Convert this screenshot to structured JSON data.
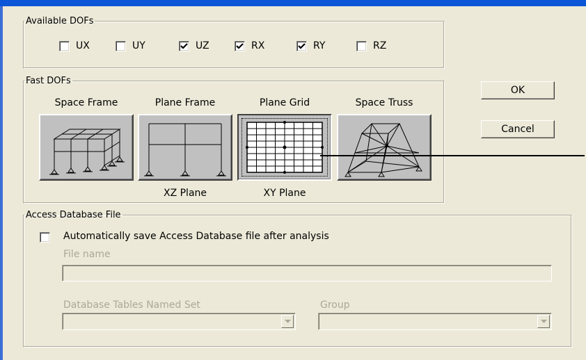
{
  "available_dofs": {
    "title": "Available DOFs",
    "items": [
      {
        "label": "UX",
        "checked": false
      },
      {
        "label": "UY",
        "checked": false
      },
      {
        "label": "UZ",
        "checked": true
      },
      {
        "label": "RX",
        "checked": true
      },
      {
        "label": "RY",
        "checked": true
      },
      {
        "label": "RZ",
        "checked": false
      }
    ]
  },
  "fast_dofs": {
    "title": "Fast DOFs",
    "buttons": [
      {
        "label": "Space Frame",
        "sublabel": "",
        "pressed": false,
        "icon": "space-frame-icon"
      },
      {
        "label": "Plane Frame",
        "sublabel": "XZ Plane",
        "pressed": false,
        "icon": "plane-frame-icon"
      },
      {
        "label": "Plane Grid",
        "sublabel": "XY Plane",
        "pressed": true,
        "icon": "plane-grid-icon"
      },
      {
        "label": "Space Truss",
        "sublabel": "",
        "pressed": false,
        "icon": "space-truss-icon"
      }
    ]
  },
  "actions": {
    "ok_label": "OK",
    "cancel_label": "Cancel"
  },
  "access_db": {
    "title": "Access Database File",
    "auto_save_label": "Automatically save Access Database file after analysis",
    "auto_save_checked": false,
    "file_name_label": "File name",
    "file_name_value": "",
    "tables_label": "Database Tables Named Set",
    "tables_value": "",
    "group_label": "Group",
    "group_value": ""
  },
  "colors": {
    "dialog_bg": "#ece9d8",
    "title_bar": "#0a56d6",
    "button_face": "#c0c0c0",
    "disabled_text": "#aca899"
  }
}
